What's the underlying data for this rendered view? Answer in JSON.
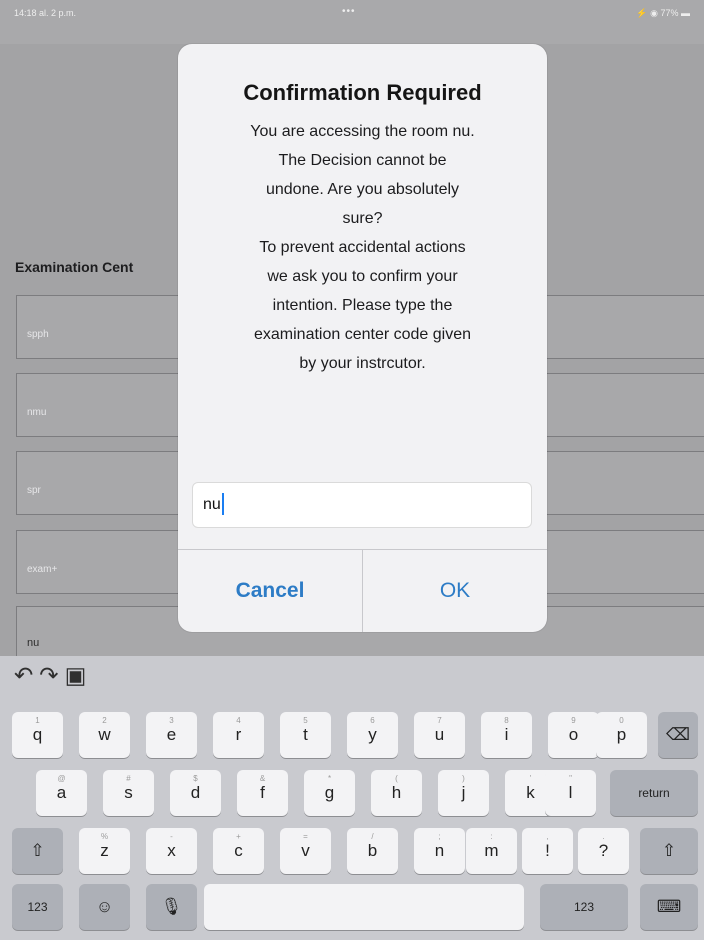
{
  "status_bar": {
    "time": "14:18  al. 2 p.m.",
    "dots": "•••",
    "battery": "⚡ ◉ 77% ▬"
  },
  "nav": {
    "more": "•••"
  },
  "form": {
    "section_label": "Examination Cent",
    "fields": [
      "spph",
      "nmu",
      "spr",
      "exam+",
      "nu"
    ]
  },
  "dialog": {
    "title": "Confirmation Required",
    "message_lines": [
      "You are accessing the room nu.",
      "The Decision cannot be",
      "undone. Are you absolutely",
      "sure?",
      "To prevent accidental actions",
      "we ask you to confirm your",
      "intention. Please type the",
      "examination center code given",
      "by your instrcutor."
    ],
    "input_value": "nu",
    "cancel_label": "Cancel",
    "ok_label": "OK"
  },
  "keyboard": {
    "toolbar_icons": [
      "undo-icon",
      "redo-icon",
      "clipboard-icon"
    ],
    "row1": [
      "q",
      "w",
      "e",
      "r",
      "t",
      "y",
      "u",
      "i",
      "o",
      "p"
    ],
    "row1_hints": [
      "1",
      "2",
      "3",
      "4",
      "5",
      "6",
      "7",
      "8",
      "9",
      "0"
    ],
    "row2": [
      "a",
      "s",
      "d",
      "f",
      "g",
      "h",
      "j",
      "k",
      "l"
    ],
    "row2_hints": [
      "@",
      "#",
      "$",
      "&",
      "*",
      "(",
      ")",
      "'",
      "\""
    ],
    "row3": [
      "z",
      "x",
      "c",
      "v",
      "b",
      "n",
      "m",
      "!",
      "?"
    ],
    "row3_hints": [
      "%",
      "-",
      "+",
      "=",
      "/",
      ";",
      ":",
      ",",
      "."
    ],
    "return_label": "return",
    "numbers_label": "123",
    "colors": {
      "background": "#c9cacf",
      "key": "#f3f3f5",
      "dark_key": "#adb0b7"
    }
  },
  "colors": {
    "accent": "#2d7cc6",
    "dim_overlay": "#a3a3a5"
  }
}
